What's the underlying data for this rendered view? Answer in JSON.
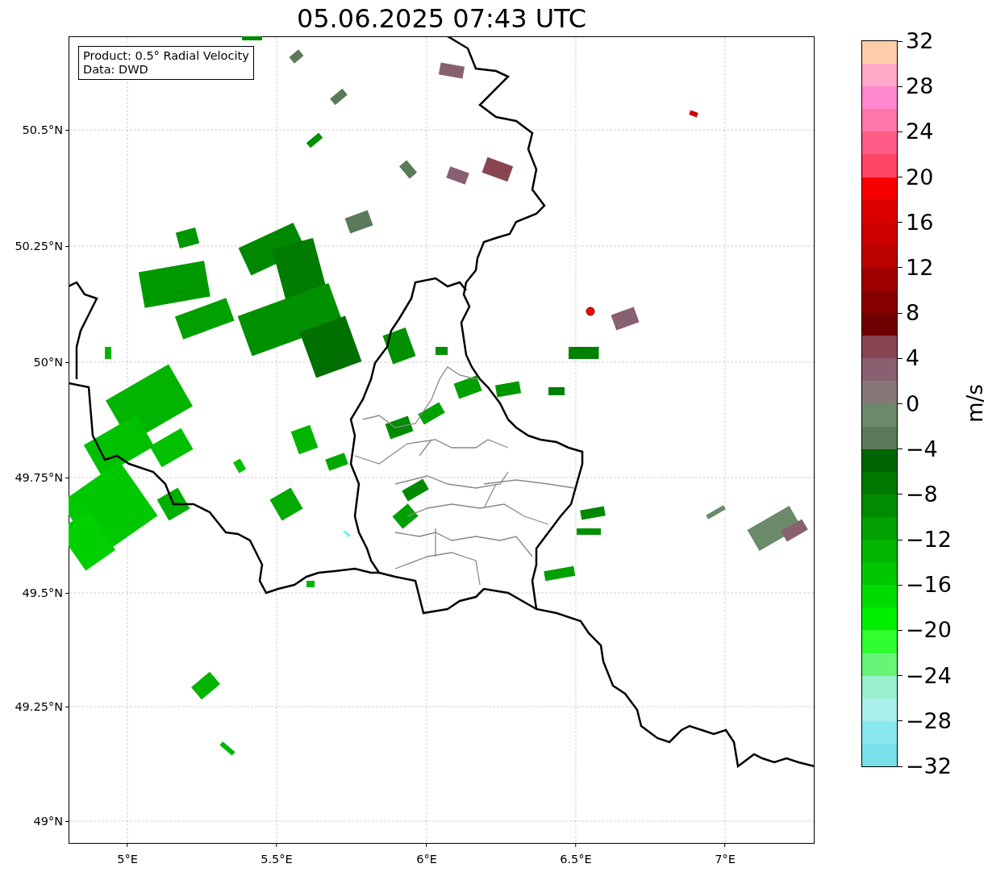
{
  "title": "05.06.2025 07:43 UTC",
  "map": {
    "info_box": [
      "Product: 0.5° Radial Velocity",
      "Data: DWD"
    ],
    "y_ticks": [
      "50.5°N",
      "50.25°N",
      "50°N",
      "49.75°N",
      "49.5°N",
      "49.25°N",
      "49°N"
    ],
    "x_ticks": [
      "5°E",
      "5.5°E",
      "6°E",
      "6.5°E",
      "7°E"
    ]
  },
  "colorbar": {
    "label": "m/s",
    "ticks": [
      "32",
      "28",
      "24",
      "20",
      "16",
      "12",
      "8",
      "4",
      "0",
      "−4",
      "−8",
      "−12",
      "−16",
      "−20",
      "−24",
      "−28",
      "−32"
    ],
    "bands": [
      {
        "color": "#ffccaa"
      },
      {
        "color": "#ffaac8"
      },
      {
        "color": "#ff88d0"
      },
      {
        "color": "#ff77aa"
      },
      {
        "color": "#ff5a88"
      },
      {
        "color": "#ff4466"
      },
      {
        "color": "#f80000"
      },
      {
        "color": "#dd0000"
      },
      {
        "color": "#cc0000"
      },
      {
        "color": "#bb0000"
      },
      {
        "color": "#a00000"
      },
      {
        "color": "#880000"
      },
      {
        "color": "#700000"
      },
      {
        "color": "#884450"
      },
      {
        "color": "#886070"
      },
      {
        "color": "#887777"
      },
      {
        "color": "#6a8a6a"
      },
      {
        "color": "#5a7a5a"
      },
      {
        "color": "#006400"
      },
      {
        "color": "#007800"
      },
      {
        "color": "#008c00"
      },
      {
        "color": "#00a000"
      },
      {
        "color": "#00b400"
      },
      {
        "color": "#00c800"
      },
      {
        "color": "#00dc00"
      },
      {
        "color": "#00f000"
      },
      {
        "color": "#30ff30"
      },
      {
        "color": "#66f577"
      },
      {
        "color": "#99f0cc"
      },
      {
        "color": "#aaeeee"
      },
      {
        "color": "#88e8ee"
      },
      {
        "color": "#77e0e8"
      }
    ]
  }
}
